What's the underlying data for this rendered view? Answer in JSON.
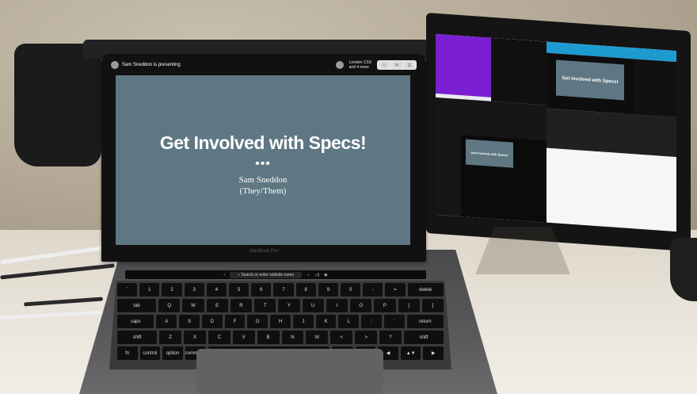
{
  "meet": {
    "presenter_text": "Sam Sneddon is presenting",
    "people_text_line1": "London CSS",
    "people_text_line2": "and 4 more"
  },
  "slide": {
    "title": "Get Involved with Specs!",
    "dots": "•••",
    "author_name": "Sam Sneddon",
    "author_pronouns": "(They/Them)"
  },
  "laptop": {
    "brand": "MacBook Pro",
    "touchbar_url": "Search or enter website name"
  },
  "side_slide": {
    "title": "Get Involved with Specs!"
  },
  "keyboard": {
    "row1": [
      "`",
      "1",
      "2",
      "3",
      "4",
      "5",
      "6",
      "7",
      "8",
      "9",
      "0",
      "-",
      "=",
      "delete"
    ],
    "row2": [
      "tab",
      "Q",
      "W",
      "E",
      "R",
      "T",
      "Y",
      "U",
      "I",
      "O",
      "P",
      "[",
      "]"
    ],
    "row3": [
      "caps",
      "A",
      "S",
      "D",
      "F",
      "G",
      "H",
      "J",
      "K",
      "L",
      ";",
      "'",
      "return"
    ],
    "row4": [
      "shift",
      "Z",
      "X",
      "C",
      "V",
      "B",
      "N",
      "M",
      "<",
      ">",
      "?",
      "shift"
    ],
    "row5": [
      "fn",
      "control",
      "option",
      "command",
      "",
      "command",
      "option",
      "◀",
      "▲▼",
      "▶"
    ]
  },
  "colors": {
    "slide_bg": "#5e7783",
    "purple_pane": "#7a1fd1",
    "stream_bar": "#1d9bd1"
  }
}
